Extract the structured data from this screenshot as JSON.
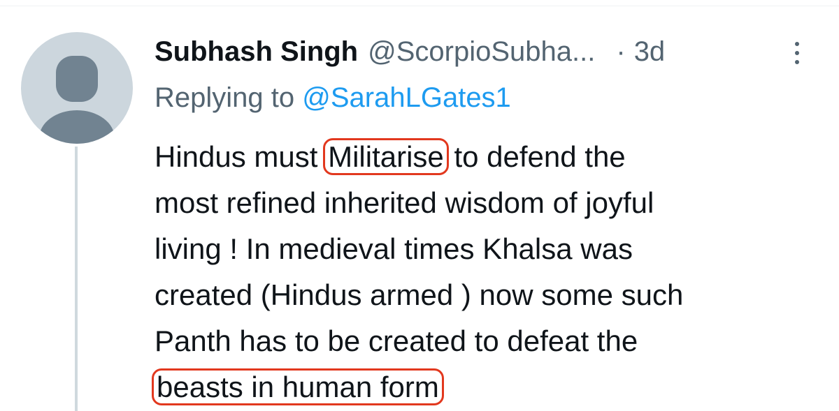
{
  "tweet": {
    "author_name": "Subhash Singh",
    "author_handle": "@ScorpioSubha...",
    "separator": "·",
    "time": "3d",
    "more_icon": "more-vertical-icon",
    "avatar_icon": "default-avatar-icon",
    "replying_prefix": "Replying to",
    "replying_mention": "@SarahLGates1",
    "body_lines": [
      {
        "before": "Hindus must ",
        "highlight": "Militarise",
        "after": " to defend the"
      },
      {
        "text": "most refined inherited wisdom of joyful"
      },
      {
        "text": "living ! In medieval times Khalsa was"
      },
      {
        "text": "created (Hindus armed ) now some such"
      },
      {
        "text": "Panth has to be created to defeat the"
      },
      {
        "highlight": "beasts in human form"
      }
    ]
  },
  "colors": {
    "primary_text": "#0f1419",
    "secondary_text": "#536471",
    "link": "#1d9bf0",
    "annotation": "#e2381e",
    "avatar_bg": "#ccd6dd",
    "avatar_figure": "#718391",
    "thread_line": "#cfd9de"
  }
}
